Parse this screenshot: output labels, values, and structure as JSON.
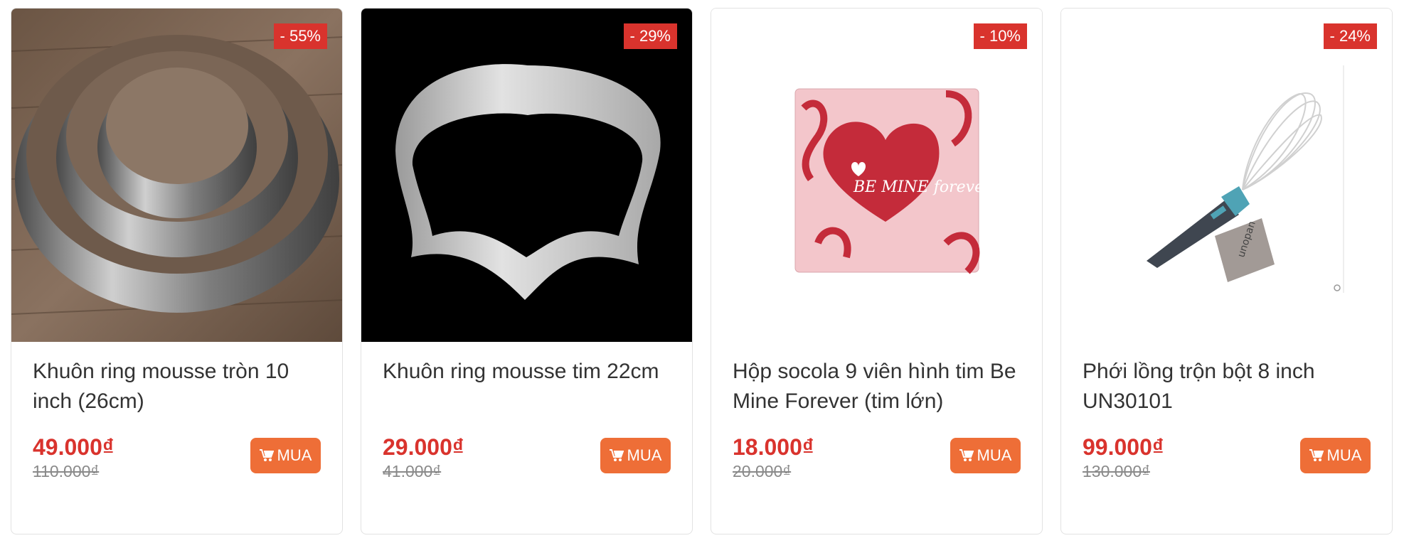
{
  "products": [
    {
      "discount": "- 55%",
      "name": "Khuôn ring mousse tròn 10 inch (26cm)",
      "price": "49.000₫",
      "old_price": "110.000₫",
      "buy_label": "MUA",
      "image_icon": "round-ring-mold"
    },
    {
      "discount": "- 29%",
      "name": "Khuôn ring mousse tim 22cm",
      "price": "29.000₫",
      "old_price": "41.000₫",
      "buy_label": "MUA",
      "image_icon": "heart-ring-mold"
    },
    {
      "discount": "- 10%",
      "name": "Hộp socola 9 viên hình tim Be Mine Forever (tim lớn)",
      "price": "18.000₫",
      "old_price": "20.000₫",
      "buy_label": "MUA",
      "image_icon": "chocolate-box",
      "image_text": "BE MINE forever"
    },
    {
      "discount": "- 24%",
      "name": "Phới lồng trộn bột 8 inch UN30101",
      "price": "99.000₫",
      "old_price": "130.000₫",
      "buy_label": "MUA",
      "image_icon": "whisk",
      "image_text": "unopan"
    }
  ],
  "colors": {
    "accent": "#d9332d",
    "button": "#ee6e37"
  },
  "icons": {
    "cart": "cart-icon"
  }
}
